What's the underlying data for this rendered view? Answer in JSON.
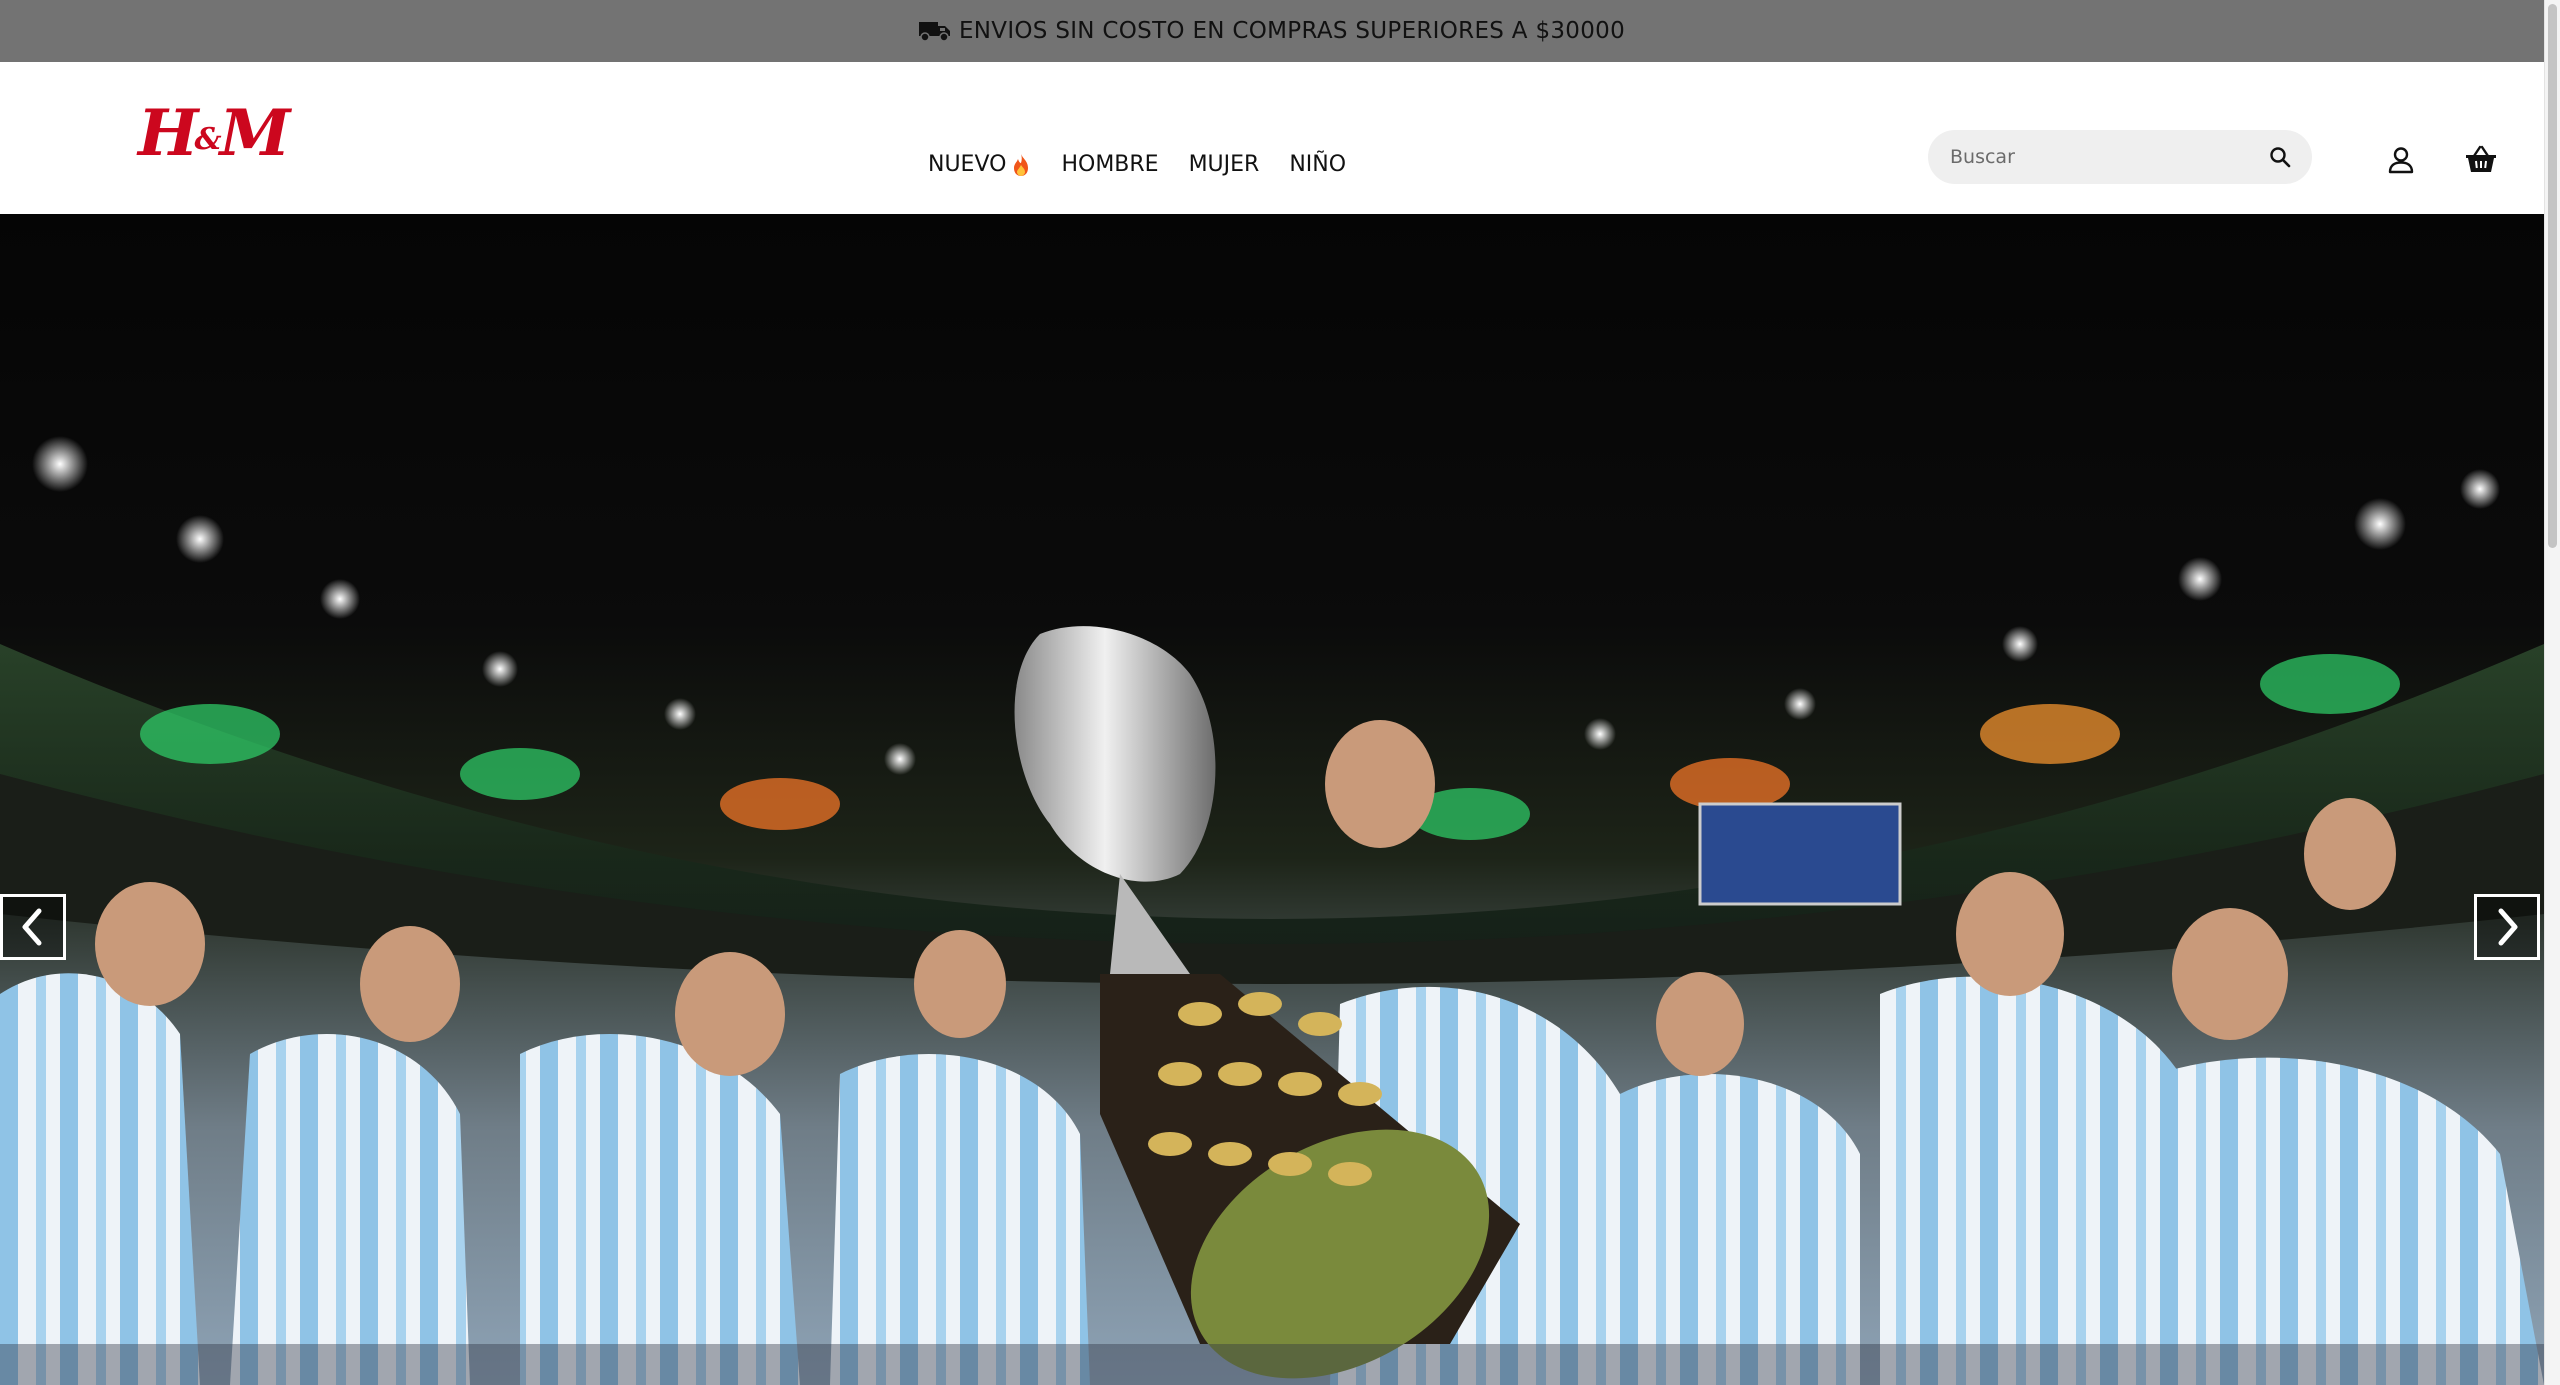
{
  "promo": {
    "icon": "truck-icon",
    "text": "ENVIOS SIN COSTO EN COMPRAS SUPERIORES A $30000"
  },
  "header": {
    "logo": {
      "text": "H&M",
      "color": "#cc071e"
    },
    "nav": [
      {
        "label": "NUEVO",
        "icon": "flame-icon"
      },
      {
        "label": "HOMBRE"
      },
      {
        "label": "MUJER"
      },
      {
        "label": "NIÑO"
      }
    ],
    "search": {
      "placeholder": "Buscar",
      "value": "",
      "icon": "search-icon"
    },
    "user_icon": "user-icon",
    "cart_icon": "basket-icon"
  },
  "hero": {
    "image": "football-team-celebrating-with-trophy-in-stadium",
    "prev_icon": "chevron-left-icon",
    "next_icon": "chevron-right-icon"
  },
  "colors": {
    "promo_bar": "#737373",
    "brand_red": "#cc071e",
    "search_bg": "#efefef"
  }
}
